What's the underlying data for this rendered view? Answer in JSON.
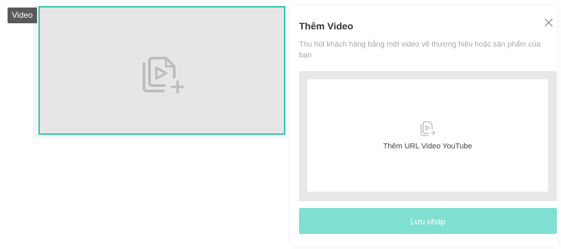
{
  "section": {
    "tag_label": "Video",
    "placeholder_icon": "add-video-icon"
  },
  "panel": {
    "title": "Thêm Video",
    "close_icon": "close-icon",
    "description": "Thu hút khách hàng bằng một video về thương hiệu hoặc sản phẩm của bạn",
    "dropzone_label": "Thêm URL Video YouTube",
    "dropzone_icon": "add-video-icon",
    "save_label": "Lưu nháp"
  },
  "colors": {
    "accent": "#2ec4ad",
    "save_button": "#7fe0d1",
    "tag_bg": "#5a5a5a",
    "placeholder_bg": "#e6e6e6"
  }
}
